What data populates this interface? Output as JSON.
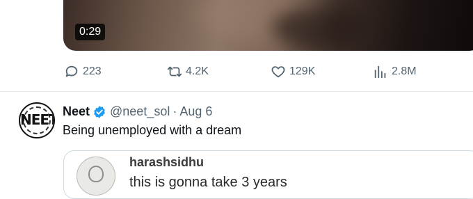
{
  "video": {
    "duration": "0:29"
  },
  "actions": {
    "replies": "223",
    "reposts": "4.2K",
    "likes": "129K",
    "views": "2.8M"
  },
  "tweet": {
    "name": "Neet",
    "handle": "@neet_sol",
    "separator": "·",
    "date": "Aug 6",
    "text": "Being unemployed with a dream",
    "avatar_text": "NEET"
  },
  "quote": {
    "username": "harashsidhu",
    "text": "this is gonna take 3 years"
  },
  "colors": {
    "secondary_text": "#536471",
    "verified": "#1d9bf0",
    "divider": "#e6ecf0"
  }
}
